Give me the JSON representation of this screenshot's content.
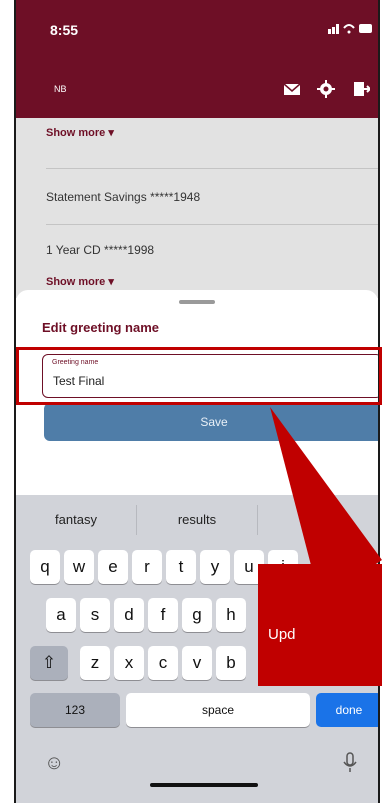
{
  "status": {
    "time": "8:55",
    "icons": "signal wifi battery"
  },
  "header": {
    "logo_text": "NB",
    "icons": [
      "mail-icon",
      "gear-icon",
      "logout-icon"
    ]
  },
  "accounts": {
    "show_more_top": "Show more ▾",
    "items": [
      {
        "name": "Statement Savings",
        "masked": "*****1948"
      },
      {
        "name": "1 Year CD",
        "masked": "*****1998"
      }
    ],
    "show_more_bottom": "Show more ▾"
  },
  "sheet": {
    "title": "Edit greeting name",
    "field_label": "Greeting name",
    "field_value": "Test Final",
    "save_label": "Save"
  },
  "keyboard": {
    "suggestions": [
      "fantasy",
      "results",
      ""
    ],
    "row1": [
      "q",
      "w",
      "e",
      "r",
      "t",
      "y",
      "u",
      "i"
    ],
    "row2": [
      "a",
      "s",
      "d",
      "f",
      "g",
      "h"
    ],
    "row3": [
      "z",
      "x",
      "c",
      "v",
      "b"
    ],
    "shift": "⇧",
    "num": "123",
    "space": "space",
    "done": "done",
    "emoji": "☺",
    "mic": "🎙"
  },
  "callout": {
    "text": "Upd",
    "color": "#c00000"
  },
  "colors": {
    "brand": "#6e0f26",
    "save": "#4f7da8",
    "highlight": "#c00000"
  }
}
